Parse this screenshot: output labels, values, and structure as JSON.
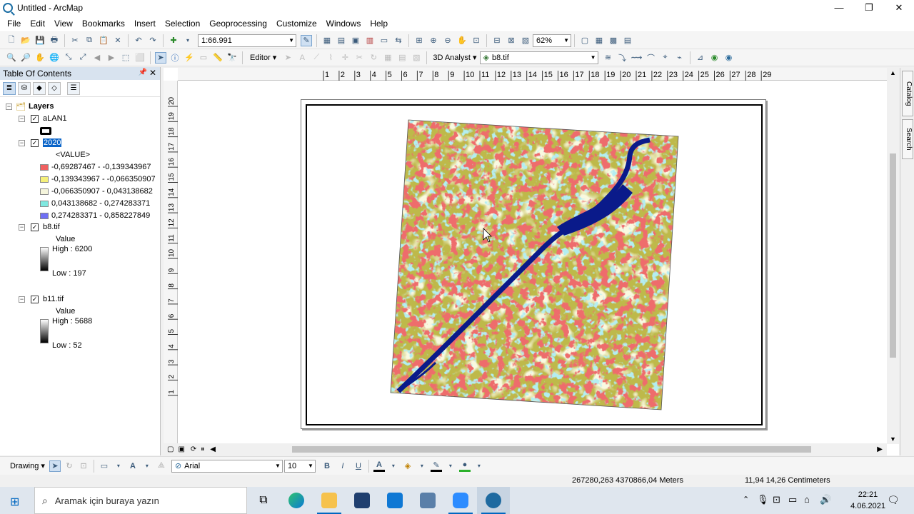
{
  "window": {
    "title": "Untitled - ArcMap",
    "controls": [
      "—",
      "❐",
      "✕"
    ]
  },
  "menu": [
    "File",
    "Edit",
    "View",
    "Bookmarks",
    "Insert",
    "Selection",
    "Geoprocessing",
    "Customize",
    "Windows",
    "Help"
  ],
  "toolbar": {
    "scale": "1:66.991",
    "zoom": "62%",
    "editor_label": "Editor ▾",
    "analyst_label": "3D Analyst ▾",
    "layer_combo": "b8.tif"
  },
  "toc": {
    "title": "Table Of Contents",
    "root": "Layers",
    "layers": [
      {
        "name": "aLAN1"
      },
      {
        "name": "2020",
        "field": "<VALUE>",
        "classes": [
          {
            "label": "-0,69287467 - -0,139343967",
            "color": "#f06060"
          },
          {
            "label": "-0,139343967 - -0,066350907",
            "color": "#f5f07a"
          },
          {
            "label": "-0,066350907 - 0,043138682",
            "color": "#f5f5dc"
          },
          {
            "label": "0,043138682 - 0,274283371",
            "color": "#7fe8e0"
          },
          {
            "label": "0,274283371 - 0,858227849",
            "color": "#7070f5"
          }
        ]
      },
      {
        "name": "b8.tif",
        "field": "Value",
        "high": "High : 6200",
        "low": "Low : 197"
      },
      {
        "name": "b11.tif",
        "field": "Value",
        "high": "High : 5688",
        "low": "Low : 52"
      }
    ]
  },
  "ruler_top": [
    "1",
    "2",
    "3",
    "4",
    "5",
    "6",
    "7",
    "8",
    "9",
    "10",
    "11",
    "12",
    "13",
    "14",
    "15",
    "16",
    "17",
    "18",
    "19",
    "20",
    "21",
    "22",
    "23",
    "24",
    "25",
    "26",
    "27",
    "28",
    "29"
  ],
  "ruler_left": [
    "20",
    "19",
    "18",
    "17",
    "16",
    "15",
    "14",
    "13",
    "12",
    "11",
    "10",
    "9",
    "8",
    "7",
    "6",
    "5",
    "4",
    "3",
    "2",
    "1"
  ],
  "side_tabs": [
    "Catalog",
    "Search"
  ],
  "drawing": {
    "label": "Drawing ▾",
    "font": "Arial",
    "size": "10",
    "bold": "B",
    "italic": "I",
    "underline": "U"
  },
  "status": {
    "coords": "267280,263  4370866,04 Meters",
    "page_coords": "11,94  14,26 Centimeters"
  },
  "taskbar": {
    "search_placeholder": "Aramak için buraya yazın",
    "time": "22:21",
    "date": "4.06.2021"
  }
}
